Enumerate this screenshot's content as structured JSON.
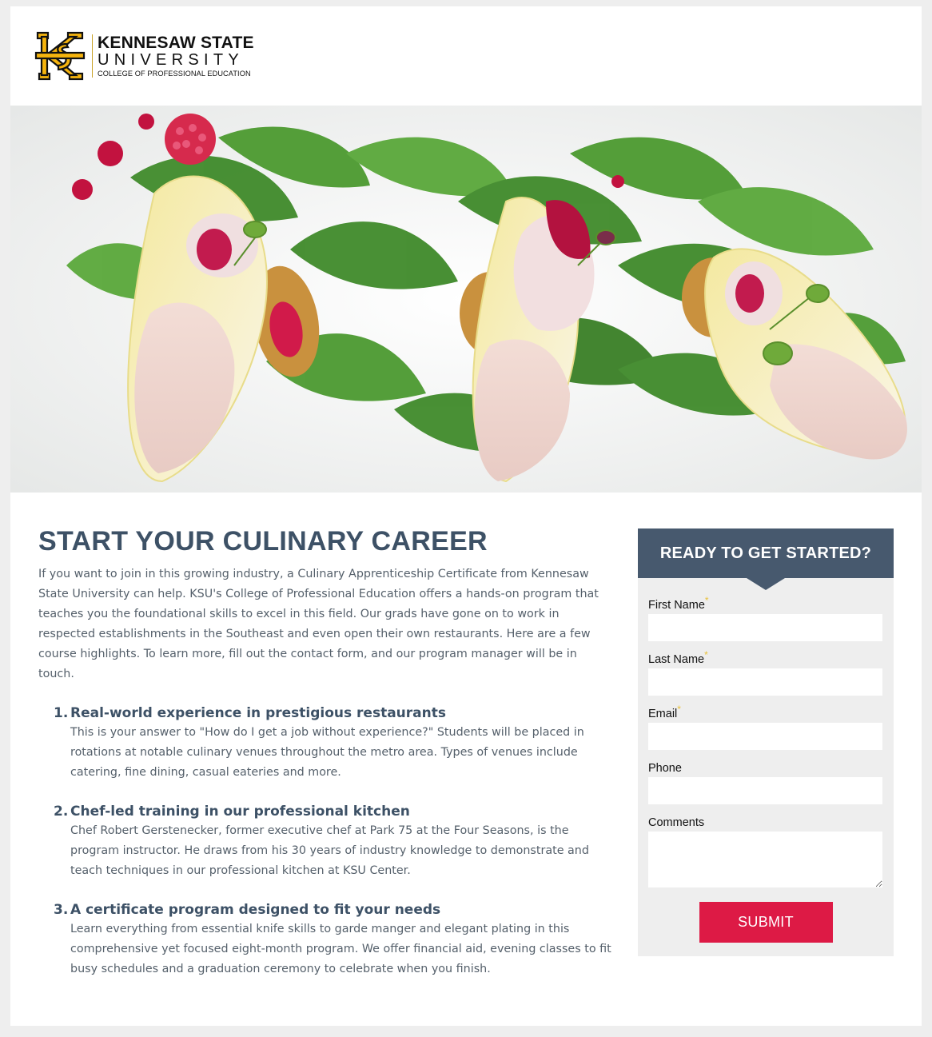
{
  "header": {
    "logo_line1": "KENNESAW STATE",
    "logo_line2": "UNIVERSITY",
    "logo_line3": "COLLEGE OF PROFESSIONAL EDUCATION"
  },
  "colors": {
    "heading": "#3d5166",
    "form_header_bg": "#47596e",
    "submit_bg": "#dd1a45",
    "required_star": "#e8c13a",
    "ksu_gold": "#f6b40e"
  },
  "main": {
    "title": "START YOUR CULINARY CAREER",
    "intro": "If you want to join in this growing industry, a Culinary Apprenticeship Certificate from Kennesaw State University can help. KSU's College of Professional Education offers a hands-on program that teaches you the foundational skills to excel in this field. Our grads have gone on to work in respected establishments in the Southeast and even open their own restaurants. Here are a few course highlights. To learn more, fill out the contact form, and our program manager will be in touch.",
    "highlights": [
      {
        "number": "1.",
        "title": "Real-world experience in prestigious restaurants",
        "body": "This is your answer to \"How do I get a job without experience?\" Students will be placed in rotations at notable culinary venues throughout the metro area. Types of venues include catering, fine dining, casual eateries and more."
      },
      {
        "number": "2.",
        "title": "Chef-led training in our professional kitchen",
        "body": "Chef Robert Gerstenecker, former executive chef at Park 75 at the Four Seasons, is the program instructor. He draws from his 30 years of industry knowledge to demonstrate and teach techniques in our professional kitchen at KSU Center."
      },
      {
        "number": "3.",
        "title": "A certificate program designed to fit your needs",
        "body": "Learn everything from essential knife skills to garde manger and elegant plating in this comprehensive yet focused eight-month program. We offer financial aid, evening classes to fit busy schedules and a graduation ceremony to celebrate when you finish."
      }
    ]
  },
  "form": {
    "title": "READY TO GET STARTED?",
    "required_mark": "*",
    "fields": {
      "first_name": {
        "label": "First Name",
        "value": ""
      },
      "last_name": {
        "label": "Last Name",
        "value": ""
      },
      "email": {
        "label": "Email",
        "value": ""
      },
      "phone": {
        "label": "Phone",
        "value": ""
      },
      "comments": {
        "label": "Comments",
        "value": ""
      }
    },
    "submit_label": "SUBMIT"
  }
}
